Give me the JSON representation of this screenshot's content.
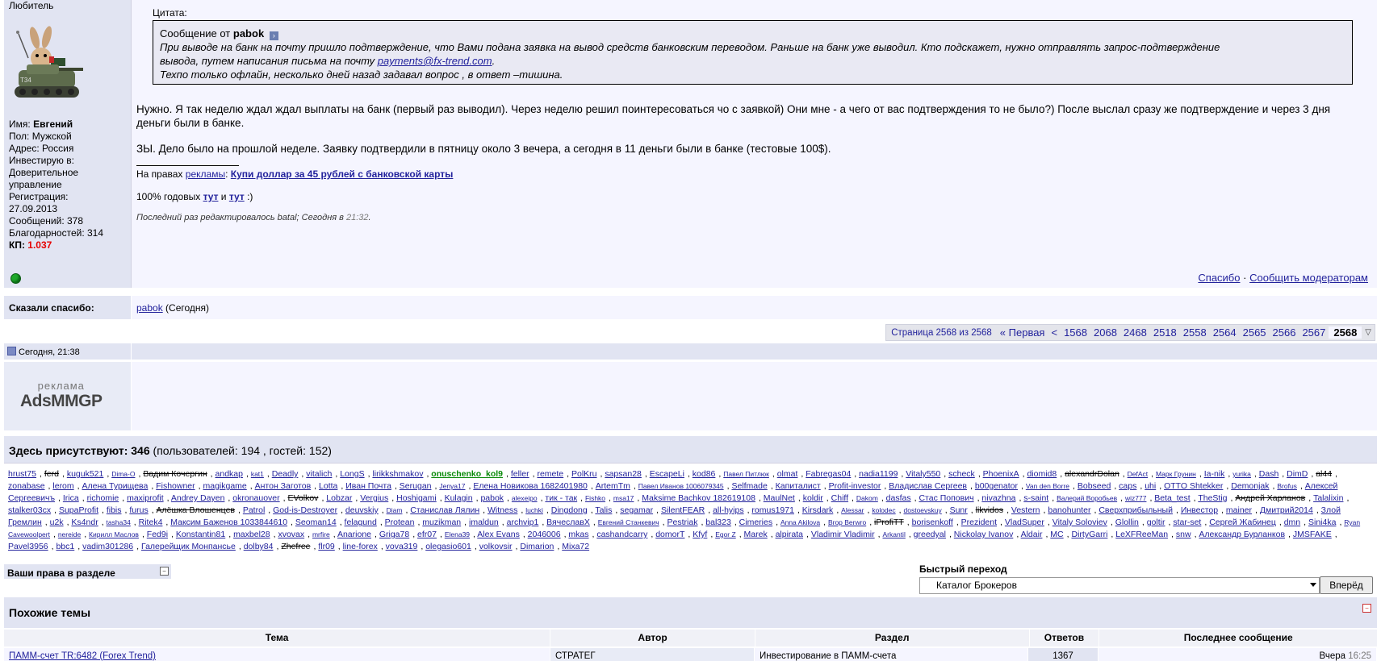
{
  "post": {
    "username": "Любитель",
    "info": {
      "name_label": "Имя:",
      "name_value": "Евгений",
      "gender": "Пол: Мужской",
      "address": "Адрес: Россия",
      "invest_label": "Инвестирую в:",
      "invest_value": "Доверительное управление",
      "reg_label": "Регистрация:",
      "reg_value": "27.09.2013",
      "messages": "Сообщений: 378",
      "thanks": "Благодарностей: 314",
      "kp_label": "КП:",
      "kp_value": "1.037"
    },
    "quote_title": "Цитата:",
    "quote_head_prefix": "Сообщение от",
    "quote_author": "pabok",
    "quote_line1": "При выводе на банк на почту пришло подтверждение, что Вами подана заявка на вывод средств банковским переводом. Раньше на банк уже выводил. Кто подскажет, нужно отправлять запрос-подтверждение",
    "quote_line2_pre": "вывода, путем написания письма на почту",
    "quote_email": "payments@fx-trend.com",
    "quote_line2_post": ".",
    "quote_line3": "Техпо только офлайн, несколько дней назад задавал вопрос , в ответ –тишина.",
    "message_p1": "Нужно. Я так неделю ждал ждал выплаты на банк (первый раз выводил). Через неделю решил поинтересоваться чо с заявкой) Они мне - а чего от вас подтверждения то не было?) После выслал сразу же подтверждение и через 3 дня деньги были в банке.",
    "message_p2": "ЗЫ. Дело было на прошлой неделе. Заявку подтвердили в пятницу около 3 вечера, а сегодня в 11 деньги были в банке (тестовые 100$).",
    "sig_prefix": "На правах",
    "sig_ads_link": "рекламы",
    "sig_colon": ":",
    "sig_link": "Купи доллар за 45 рублей с банковской карты",
    "pct_prefix": "100% годовых",
    "pct_link1": "тут",
    "pct_and": "и",
    "pct_link2": "тут",
    "pct_suffix": ":)",
    "edited_text": "Последний раз редактировалось batal; Сегодня в",
    "edited_time": "21:32",
    "edited_dot": ".",
    "action_thanks": "Спасибо",
    "action_sep": "·",
    "action_report": "Сообщить модераторам"
  },
  "thanks_row": {
    "label": "Сказали спасибо:",
    "user": "pabok",
    "when": "(Сегодня)"
  },
  "pager": {
    "info": "Страница 2568 из 2568",
    "first": "« Первая",
    "prev": "<",
    "pages": [
      "1568",
      "2068",
      "2468",
      "2518",
      "2558",
      "2564",
      "2565",
      "2566",
      "2567"
    ],
    "current": "2568"
  },
  "ad_post": {
    "date": "Сегодня, 21:38",
    "logo_small": "реклама",
    "logo_big": "AdsMMGP"
  },
  "online": {
    "title_bold": "Здесь присутствуют: 346",
    "title_rest": "(пользователей: 194 , гостей: 152)",
    "users": [
      {
        "n": "hrust75"
      },
      {
        "n": "ferd",
        "st": 1
      },
      {
        "n": "kuguk521"
      },
      {
        "n": "Dima-O",
        "sm": 1
      },
      {
        "n": "Вадим Кочергин",
        "st": 1
      },
      {
        "n": "andkap"
      },
      {
        "n": "kat1",
        "sm": 1
      },
      {
        "n": "Deadly"
      },
      {
        "n": "vitalich"
      },
      {
        "n": "LongS"
      },
      {
        "n": "lirikkshmakov"
      },
      {
        "n": "onuschenko_kol9",
        "gr": 1
      },
      {
        "n": "feller"
      },
      {
        "n": "remete"
      },
      {
        "n": "PolKru"
      },
      {
        "n": "sapsan28"
      },
      {
        "n": "EscapeLi"
      },
      {
        "n": "kod86"
      },
      {
        "n": "Павел Питлюк",
        "sm": 1
      },
      {
        "n": "olmat"
      },
      {
        "n": "Fabregas04"
      },
      {
        "n": "nadia1199"
      },
      {
        "n": "Vitaly550"
      },
      {
        "n": "scheck"
      },
      {
        "n": "PhoenixA"
      },
      {
        "n": "diomid8"
      },
      {
        "n": "alexandrDolan",
        "st": 1
      },
      {
        "n": "DefAct",
        "sm": 1
      },
      {
        "n": "Марк Грунин",
        "sm": 1
      },
      {
        "n": "Ia-nik"
      },
      {
        "n": "yurika",
        "sm": 1
      },
      {
        "n": "Dash"
      },
      {
        "n": "DimD"
      },
      {
        "n": "al44",
        "st": 1
      },
      {
        "n": "zonabase"
      },
      {
        "n": "lerom"
      },
      {
        "n": "Алена Турищева"
      },
      {
        "n": "Fishowner"
      },
      {
        "n": "magikgame"
      },
      {
        "n": "Антон Заготов"
      },
      {
        "n": "Lotta"
      },
      {
        "n": "Иван Почта"
      },
      {
        "n": "Serugan"
      },
      {
        "n": "Jenya17",
        "sm": 1
      },
      {
        "n": "Елена Новикова 1682401980"
      },
      {
        "n": "ArtemTm"
      },
      {
        "n": "Павел Иванов 1006079345",
        "sm": 1
      },
      {
        "n": "Selfmade"
      },
      {
        "n": "Капиталист"
      },
      {
        "n": "Profit-investor"
      },
      {
        "n": "Владислав Сергеев"
      },
      {
        "n": "b00genator"
      },
      {
        "n": "Van den Borre",
        "sm": 1
      },
      {
        "n": "Bobseed"
      },
      {
        "n": "caps"
      },
      {
        "n": "uhi"
      },
      {
        "n": "OTTO Shtekker"
      },
      {
        "n": "Demonjak"
      },
      {
        "n": "Brofus",
        "sm": 1
      },
      {
        "n": "Алексей Сергеевичъ"
      },
      {
        "n": "Irica"
      },
      {
        "n": "richomie"
      },
      {
        "n": "maxiprofit"
      },
      {
        "n": "Andrey Dayen"
      },
      {
        "n": "okronauover"
      },
      {
        "n": "EVolkov",
        "st": 1
      },
      {
        "n": "Lobzar"
      },
      {
        "n": "Vergius"
      },
      {
        "n": "Hoshigami"
      },
      {
        "n": "Kulagin"
      },
      {
        "n": "pabok"
      },
      {
        "n": "alexeipo",
        "sm": 1
      },
      {
        "n": "тик - так"
      },
      {
        "n": "Fishko",
        "sm": 1
      },
      {
        "n": "msa17",
        "sm": 1
      },
      {
        "n": "Maksime Bachkov 182619108"
      },
      {
        "n": "MaulNet"
      },
      {
        "n": "koldir"
      },
      {
        "n": "Chiff"
      },
      {
        "n": "Dakom",
        "sm": 1
      },
      {
        "n": "dasfas"
      },
      {
        "n": "Стас Попович"
      },
      {
        "n": "nivazhna"
      },
      {
        "n": "s-saint"
      },
      {
        "n": "Валерий Воробьев",
        "sm": 1
      },
      {
        "n": "wiz777",
        "sm": 1
      },
      {
        "n": "Beta_test"
      },
      {
        "n": "TheStig"
      },
      {
        "n": "Андрей Харланов",
        "st": 1
      },
      {
        "n": "Talalixin"
      },
      {
        "n": "stalker03cx"
      },
      {
        "n": "SupaProfit"
      },
      {
        "n": "fibis"
      },
      {
        "n": "furus"
      },
      {
        "n": "Алёшка Влошенцев",
        "st": 1
      },
      {
        "n": "Patrol"
      },
      {
        "n": "God-is-Destroyer"
      },
      {
        "n": "deuvskiy"
      },
      {
        "n": "Diam",
        "sm": 1
      },
      {
        "n": "Станислав Лялин"
      },
      {
        "n": "Witness"
      },
      {
        "n": "luchki",
        "sm": 1
      },
      {
        "n": "Dingdong"
      },
      {
        "n": "Talis"
      },
      {
        "n": "segamar"
      },
      {
        "n": "SilentFEAR"
      },
      {
        "n": "all-hyips"
      },
      {
        "n": "romus1971"
      },
      {
        "n": "Kirsdark"
      },
      {
        "n": "Alessar",
        "sm": 1
      },
      {
        "n": "kolodec",
        "sm": 1
      },
      {
        "n": "dostoevskuy",
        "sm": 1
      },
      {
        "n": "Sunr"
      },
      {
        "n": "likvidos",
        "st": 1
      },
      {
        "n": "Vestern"
      },
      {
        "n": "banohunter"
      },
      {
        "n": "Сверхприбыльный"
      },
      {
        "n": "Инвестор"
      },
      {
        "n": "mainer"
      },
      {
        "n": "Дмитрий2014"
      },
      {
        "n": "Злой Гремлин"
      },
      {
        "n": "u2k"
      },
      {
        "n": "Ks4ndr"
      },
      {
        "n": "tasha34",
        "sm": 1
      },
      {
        "n": "Ritek4"
      },
      {
        "n": "Максим Баженов 1033844610"
      },
      {
        "n": "Seoman14"
      },
      {
        "n": "felagund"
      },
      {
        "n": "Protean"
      },
      {
        "n": "muzikman"
      },
      {
        "n": "imaldun"
      },
      {
        "n": "archvip1"
      },
      {
        "n": "ВячеславХ"
      },
      {
        "n": "Евгений Станкевич",
        "sm": 1
      },
      {
        "n": "Pestriak"
      },
      {
        "n": "bal323"
      },
      {
        "n": "Cimeries"
      },
      {
        "n": "Anna Akilova",
        "sm": 1
      },
      {
        "n": "Brop Berwro",
        "sm": 1
      },
      {
        "n": "iProfiTT",
        "st": 1
      },
      {
        "n": "borisenkoff"
      },
      {
        "n": "Prezident"
      },
      {
        "n": "VladSuper"
      },
      {
        "n": "Vitaly Soloviev"
      },
      {
        "n": "Glollin"
      },
      {
        "n": "goltir"
      },
      {
        "n": "star-set"
      },
      {
        "n": "Сергей Жабинец"
      },
      {
        "n": "dmn"
      },
      {
        "n": "Sini4ka"
      },
      {
        "n": "Ryan Cavewoolpert",
        "sm": 1
      },
      {
        "n": "nereide",
        "sm": 1
      },
      {
        "n": "Кирилл Маслов",
        "sm": 1
      },
      {
        "n": "Fed9i"
      },
      {
        "n": "Konstantin81"
      },
      {
        "n": "maxbel28"
      },
      {
        "n": "xvovax"
      },
      {
        "n": "mrfire",
        "sm": 1
      },
      {
        "n": "Anarione"
      },
      {
        "n": "Griga78"
      },
      {
        "n": "efr07"
      },
      {
        "n": "Elena39",
        "sm": 1
      },
      {
        "n": "Alex Evans"
      },
      {
        "n": "2046006"
      },
      {
        "n": "mkas"
      },
      {
        "n": "cashandcarry"
      },
      {
        "n": "domorT"
      },
      {
        "n": "Kfyf"
      },
      {
        "n": "Egor Z",
        "sm": 1
      },
      {
        "n": "Marek"
      },
      {
        "n": "alpirata"
      },
      {
        "n": "Vladimir Vladimir"
      },
      {
        "n": "Arkantil",
        "sm": 1
      },
      {
        "n": "greedyal"
      },
      {
        "n": "Nickolay Ivanov"
      },
      {
        "n": "Aldair"
      },
      {
        "n": "MC"
      },
      {
        "n": "DirtyGarri"
      },
      {
        "n": "LeXFReeMan"
      },
      {
        "n": "snw"
      },
      {
        "n": "Александр Бурланков"
      },
      {
        "n": "JMSFAKE"
      },
      {
        "n": "Pavel3956"
      },
      {
        "n": "bbc1"
      },
      {
        "n": "vadim301286"
      },
      {
        "n": "Галерейщик Монпансье"
      },
      {
        "n": "dolby84"
      },
      {
        "n": "Zhefree",
        "st": 1
      },
      {
        "n": "flr09"
      },
      {
        "n": "line-forex"
      },
      {
        "n": "vova319"
      },
      {
        "n": "olegasio601"
      },
      {
        "n": "volkovsir"
      },
      {
        "n": "Dimarion"
      },
      {
        "n": "Mixa72"
      }
    ]
  },
  "rights": {
    "title": "Ваши права в разделе",
    "toggle": "−"
  },
  "quick_nav": {
    "title": "Быстрый переход",
    "selected": "Каталог Брокеров",
    "button": "Вперёд"
  },
  "similar": {
    "title": "Похожие темы",
    "toggle": "−",
    "columns": [
      "Тема",
      "Автор",
      "Раздел",
      "Ответов",
      "Последнее сообщение"
    ],
    "row": {
      "topic": "ПАММ-счет TR:6482 (Forex Trend)",
      "author": "СТРАТЕГ",
      "section": "Инвестирование в ПАММ-счета",
      "replies": "1367",
      "last_date": "Вчера",
      "last_time": "16:25"
    }
  }
}
